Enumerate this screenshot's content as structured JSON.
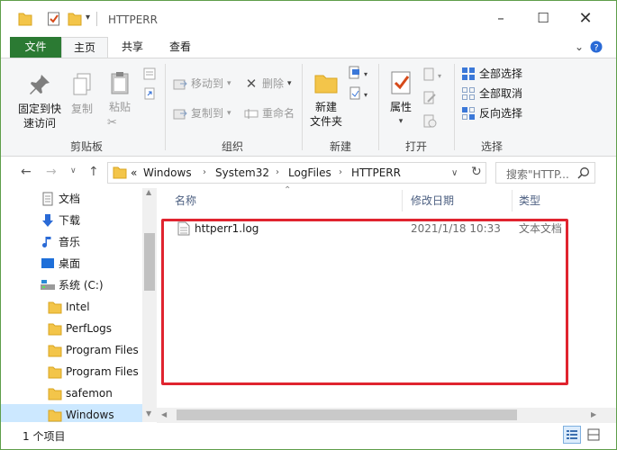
{
  "window": {
    "title": "HTTPERR"
  },
  "ribbon_tabs": [
    {
      "label": "文件"
    },
    {
      "label": "主页"
    },
    {
      "label": "共享"
    },
    {
      "label": "查看"
    }
  ],
  "ribbon": {
    "clipboard": {
      "pin_label": "固定到快\n速访问",
      "copy_label": "复制",
      "paste_label": "粘贴",
      "group_label": "剪贴板"
    },
    "organize": {
      "move_to": "移动到",
      "delete": "删除",
      "copy_to": "复制到",
      "rename": "重命名",
      "group_label": "组织"
    },
    "new": {
      "new_folder": "新建\n文件夹",
      "group_label": "新建"
    },
    "open": {
      "properties": "属性",
      "group_label": "打开"
    },
    "select": {
      "select_all": "全部选择",
      "select_none": "全部取消",
      "invert": "反向选择",
      "group_label": "选择"
    }
  },
  "address": {
    "overflow": "«",
    "segments": [
      "Windows",
      "System32",
      "LogFiles",
      "HTTPERR"
    ],
    "search_placeholder": "搜索\"HTTP..."
  },
  "nav": {
    "items": [
      {
        "label": "文档",
        "icon": "document-icon"
      },
      {
        "label": "下载",
        "icon": "download-icon"
      },
      {
        "label": "音乐",
        "icon": "music-icon"
      },
      {
        "label": "桌面",
        "icon": "desktop-icon"
      },
      {
        "label": "系统 (C:)",
        "icon": "drive-icon"
      },
      {
        "label": "Intel",
        "icon": "folder-icon"
      },
      {
        "label": "PerfLogs",
        "icon": "folder-icon"
      },
      {
        "label": "Program Files",
        "icon": "folder-icon"
      },
      {
        "label": "Program Files",
        "icon": "folder-icon"
      },
      {
        "label": "safemon",
        "icon": "folder-icon"
      },
      {
        "label": "Windows",
        "icon": "folder-icon"
      }
    ]
  },
  "columns": {
    "name": "名称",
    "modified": "修改日期",
    "type": "类型"
  },
  "files": [
    {
      "name": "httperr1.log",
      "modified": "2021/1/18 10:33",
      "type": "文本文档"
    }
  ],
  "status": {
    "item_count": "1 个项目"
  },
  "colors": {
    "file_tab": "#2b7a33",
    "highlight_box": "#e0242f",
    "selection": "#cce8ff"
  }
}
